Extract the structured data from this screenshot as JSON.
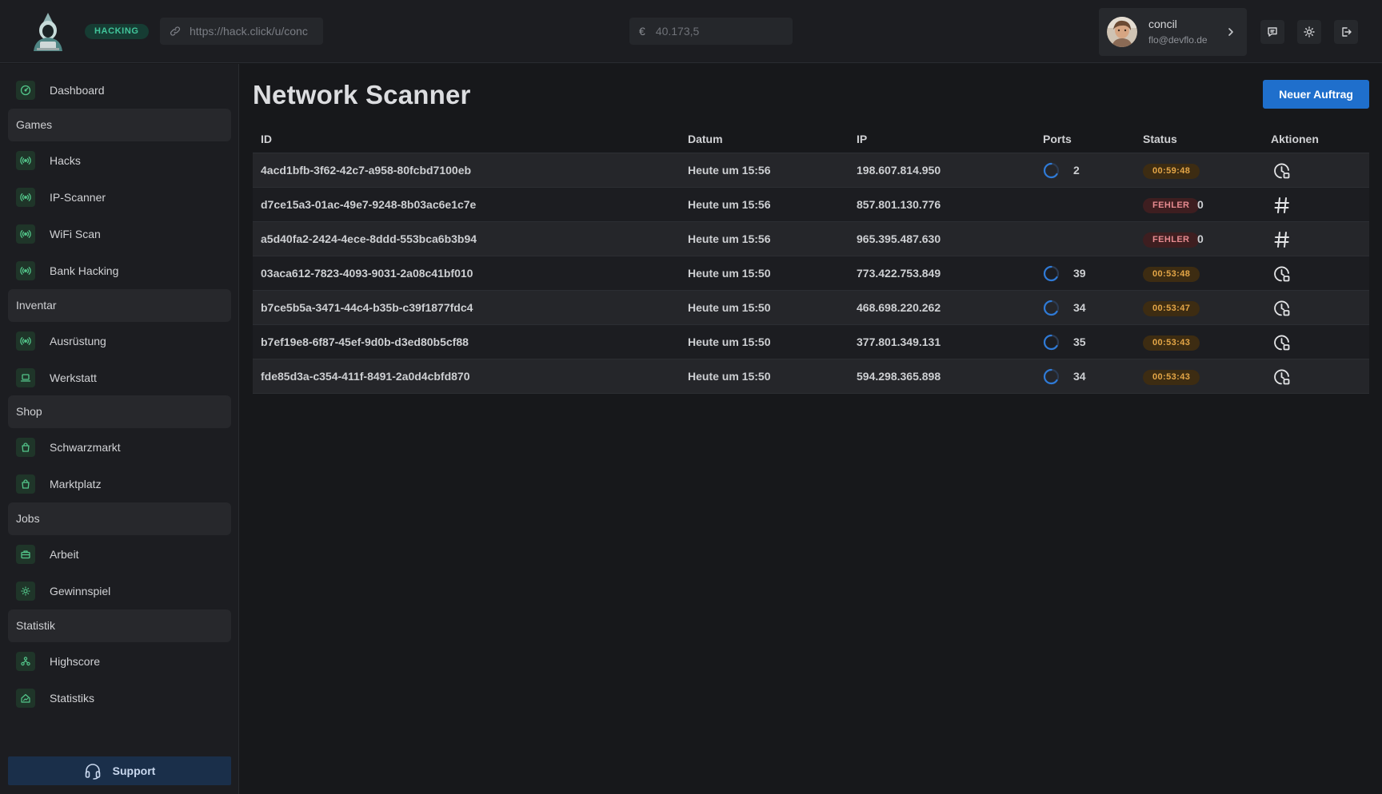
{
  "header": {
    "badge": "HACKING",
    "url_value": "https://hack.click/u/conc",
    "currency_symbol": "€",
    "balance_value": "40.173,5",
    "user": {
      "name": "concil",
      "email": "flo@devflo.de"
    }
  },
  "sidebar": {
    "items": [
      {
        "label": "Dashboard",
        "icon": "gauge-icon"
      },
      {
        "section": "Games"
      },
      {
        "label": "Hacks",
        "icon": "broadcast-icon"
      },
      {
        "label": "IP-Scanner",
        "icon": "broadcast-icon"
      },
      {
        "label": "WiFi Scan",
        "icon": "broadcast-icon"
      },
      {
        "label": "Bank Hacking",
        "icon": "broadcast-icon"
      },
      {
        "section": "Inventar"
      },
      {
        "label": "Ausrüstung",
        "icon": "broadcast-icon"
      },
      {
        "label": "Werkstatt",
        "icon": "laptop-icon"
      },
      {
        "section": "Shop"
      },
      {
        "label": "Schwarzmarkt",
        "icon": "shopping-bag-icon"
      },
      {
        "label": "Marktplatz",
        "icon": "shopping-bag-icon"
      },
      {
        "section": "Jobs"
      },
      {
        "label": "Arbeit",
        "icon": "briefcase-icon"
      },
      {
        "label": "Gewinnspiel",
        "icon": "sun-icon"
      },
      {
        "section": "Statistik"
      },
      {
        "label": "Highscore",
        "icon": "hierarchy-icon"
      },
      {
        "label": "Statistiks",
        "icon": "home-chart-icon"
      }
    ],
    "support_label": "Support"
  },
  "main": {
    "title": "Network Scanner",
    "new_button": "Neuer Auftrag",
    "columns": [
      "ID",
      "Datum",
      "IP",
      "Ports",
      "Status",
      "Aktionen"
    ],
    "rows": [
      {
        "id": "4acd1bfb-3f62-42c7-a958-80fcbd7100eb",
        "date": "Heute um 15:56",
        "ip": "198.607.814.950",
        "ports": "2",
        "status": "00:59:48",
        "status_type": "time",
        "action": "clock-icon"
      },
      {
        "id": "d7ce15a3-01ac-49e7-9248-8b03ac6e1c7e",
        "date": "Heute um 15:56",
        "ip": "857.801.130.776",
        "ports": "",
        "status": "FEHLER",
        "status_type": "error",
        "status_count": "0",
        "action": "hash-icon"
      },
      {
        "id": "a5d40fa2-2424-4ece-8ddd-553bca6b3b94",
        "date": "Heute um 15:56",
        "ip": "965.395.487.630",
        "ports": "",
        "status": "FEHLER",
        "status_type": "error",
        "status_count": "0",
        "action": "hash-icon"
      },
      {
        "id": "03aca612-7823-4093-9031-2a08c41bf010",
        "date": "Heute um 15:50",
        "ip": "773.422.753.849",
        "ports": "39",
        "status": "00:53:48",
        "status_type": "time",
        "action": "clock-icon"
      },
      {
        "id": "b7ce5b5a-3471-44c4-b35b-c39f1877fdc4",
        "date": "Heute um 15:50",
        "ip": "468.698.220.262",
        "ports": "34",
        "status": "00:53:47",
        "status_type": "time",
        "action": "clock-icon"
      },
      {
        "id": "b7ef19e8-6f87-45ef-9d0b-d3ed80b5cf88",
        "date": "Heute um 15:50",
        "ip": "377.801.349.131",
        "ports": "35",
        "status": "00:53:43",
        "status_type": "time",
        "action": "clock-icon"
      },
      {
        "id": "fde85d3a-c354-411f-8491-2a0d4cbfd870",
        "date": "Heute um 15:50",
        "ip": "594.298.365.898",
        "ports": "34",
        "status": "00:53:43",
        "status_type": "time",
        "action": "clock-icon"
      }
    ]
  },
  "colors": {
    "accent": "#1f6fcc",
    "badge_green": "#41c49a",
    "status_time": "#e4a647",
    "status_error": "#e68a8f"
  }
}
